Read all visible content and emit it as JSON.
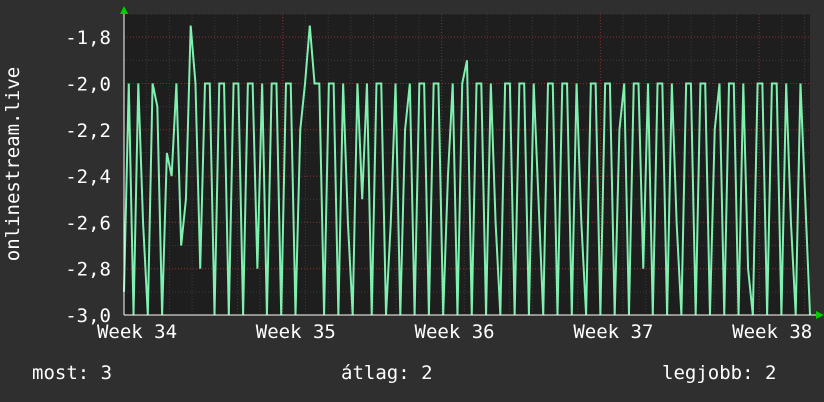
{
  "chart_data": {
    "type": "line",
    "ylabel": "onlinestream.live",
    "ylim": [
      -3.0,
      -1.7
    ],
    "yticks": [
      "-1,8",
      "-2,0",
      "-2,2",
      "-2,4",
      "-2,6",
      "-2,8",
      "-3,0"
    ],
    "ytick_values": [
      -1.8,
      -2.0,
      -2.2,
      -2.4,
      -2.6,
      -2.8,
      -3.0
    ],
    "xticks": [
      "Week 34",
      "Week 35",
      "Week 36",
      "Week 37",
      "Week 38"
    ],
    "xlim": [
      34.0,
      38.32
    ],
    "grid": true,
    "series": [
      {
        "color": "#7ff0b0",
        "x": [
          34.0,
          34.03,
          34.06,
          34.09,
          34.12,
          34.15,
          34.18,
          34.21,
          34.24,
          34.27,
          34.3,
          34.33,
          34.36,
          34.39,
          34.42,
          34.45,
          34.48,
          34.51,
          34.54,
          34.57,
          34.6,
          34.63,
          34.66,
          34.69,
          34.72,
          34.75,
          34.78,
          34.81,
          34.84,
          34.87,
          34.9,
          34.93,
          34.96,
          34.99,
          35.02,
          35.05,
          35.08,
          35.11,
          35.14,
          35.17,
          35.2,
          35.23,
          35.26,
          35.29,
          35.32,
          35.35,
          35.38,
          35.41,
          35.44,
          35.47,
          35.5,
          35.53,
          35.56,
          35.59,
          35.62,
          35.65,
          35.68,
          35.71,
          35.74,
          35.77,
          35.8,
          35.83,
          35.86,
          35.89,
          35.92,
          35.95,
          35.98,
          36.01,
          36.04,
          36.07,
          36.1,
          36.13,
          36.16,
          36.19,
          36.22,
          36.25,
          36.28,
          36.31,
          36.34,
          36.37,
          36.4,
          36.43,
          36.46,
          36.49,
          36.52,
          36.55,
          36.58,
          36.61,
          36.64,
          36.67,
          36.7,
          36.73,
          36.76,
          36.79,
          36.82,
          36.85,
          36.88,
          36.91,
          36.94,
          36.97,
          37.0,
          37.03,
          37.06,
          37.09,
          37.12,
          37.15,
          37.18,
          37.21,
          37.24,
          37.27,
          37.3,
          37.33,
          37.36,
          37.39,
          37.42,
          37.45,
          37.48,
          37.51,
          37.54,
          37.57,
          37.6,
          37.63,
          37.66,
          37.69,
          37.72,
          37.75,
          37.78,
          37.81,
          37.84,
          37.87,
          37.9,
          37.93,
          37.96,
          37.99,
          38.02,
          38.05,
          38.08,
          38.11,
          38.14,
          38.17,
          38.2,
          38.23,
          38.26,
          38.29,
          38.32
        ],
        "y": [
          -2.9,
          -2.0,
          -3.0,
          -2.0,
          -2.6,
          -3.0,
          -2.0,
          -2.1,
          -3.0,
          -2.3,
          -2.4,
          -2.0,
          -2.7,
          -2.5,
          -1.75,
          -2.0,
          -2.8,
          -2.0,
          -2.0,
          -3.0,
          -2.0,
          -2.0,
          -3.0,
          -2.0,
          -2.0,
          -3.0,
          -2.0,
          -2.0,
          -2.8,
          -2.0,
          -3.0,
          -2.0,
          -2.0,
          -3.0,
          -2.0,
          -2.0,
          -3.0,
          -2.2,
          -2.0,
          -1.75,
          -2.0,
          -2.0,
          -3.0,
          -2.0,
          -2.0,
          -3.0,
          -2.0,
          -2.6,
          -3.0,
          -2.0,
          -2.5,
          -2.0,
          -3.0,
          -2.0,
          -2.0,
          -3.0,
          -2.6,
          -2.0,
          -3.0,
          -2.2,
          -2.0,
          -3.0,
          -2.0,
          -2.0,
          -3.0,
          -2.0,
          -2.0,
          -3.0,
          -2.4,
          -2.0,
          -3.0,
          -2.0,
          -1.9,
          -3.0,
          -2.0,
          -2.0,
          -3.0,
          -2.0,
          -2.6,
          -3.0,
          -2.0,
          -2.0,
          -3.0,
          -2.0,
          -2.0,
          -3.0,
          -2.0,
          -2.5,
          -3.0,
          -2.0,
          -2.0,
          -3.0,
          -2.0,
          -2.0,
          -3.0,
          -2.0,
          -2.6,
          -3.0,
          -2.0,
          -2.0,
          -3.0,
          -2.0,
          -2.0,
          -3.0,
          -2.2,
          -2.0,
          -3.0,
          -2.0,
          -2.0,
          -2.8,
          -2.0,
          -3.0,
          -2.0,
          -2.0,
          -3.0,
          -2.0,
          -2.6,
          -3.0,
          -2.0,
          -2.0,
          -3.0,
          -2.0,
          -2.0,
          -3.0,
          -2.2,
          -2.0,
          -3.0,
          -2.0,
          -2.0,
          -3.0,
          -2.0,
          -2.8,
          -3.0,
          -2.0,
          -2.0,
          -3.0,
          -2.0,
          -2.0,
          -3.0,
          -2.0,
          -2.6,
          -3.0,
          -2.0,
          -2.5,
          -3.0
        ]
      }
    ]
  },
  "stats": {
    "current": "most: 3",
    "average": "átlag: 2",
    "best": "legjobb: 2"
  },
  "colors": {
    "background": "#2f2f2f",
    "plot_background": "#1e1e1e",
    "grid_major": "#8a2a2a",
    "grid_minor": "#3a3a3a",
    "line": "#7ff0b0",
    "axis_arrow": "#00cc00"
  }
}
